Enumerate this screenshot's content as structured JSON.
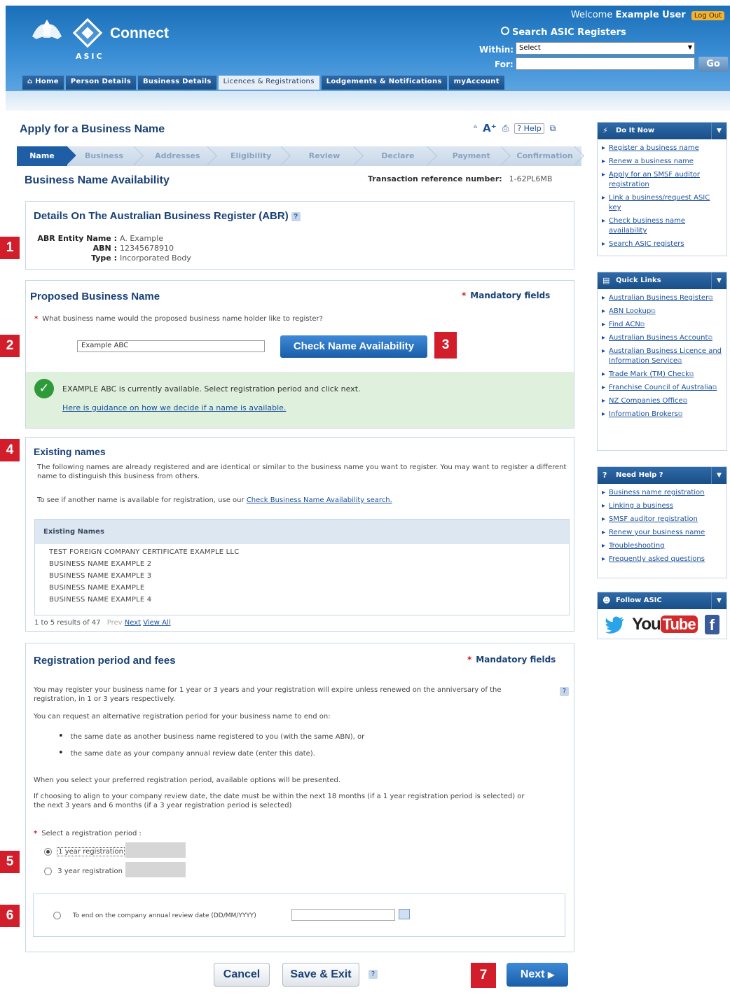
{
  "header": {
    "brand": "Connect",
    "brand_sub": "ASIC",
    "welcome_prefix": "Welcome",
    "user_name": "Example User",
    "logout_label": "Log Out",
    "search_title": "Search ASIC Registers",
    "within_label": "Within:",
    "within_value": "Select",
    "for_label": "For:",
    "go_label": "Go",
    "tabs": [
      "Home",
      "Person Details",
      "Business Details",
      "Licences & Registrations",
      "Lodgements & Notifications",
      "myAccount"
    ]
  },
  "page": {
    "title": "Apply for a Business Name",
    "help_label": "Help",
    "steps": [
      "Name",
      "Business",
      "Addresses",
      "Eligibility",
      "Review",
      "Declare",
      "Payment",
      "Confirmation"
    ],
    "section_title": "Business Name Availability",
    "txn_label": "Transaction reference number:",
    "txn_value": "1-62PL6MB"
  },
  "abr": {
    "title": "Details On The Australian Business Register (ABR)",
    "entity_label": "ABR Entity Name :",
    "entity_value": "A. Example",
    "abn_label": "ABN :",
    "abn_value": "12345678910",
    "type_label": "Type :",
    "type_value": "Incorporated Body"
  },
  "proposed": {
    "title": "Proposed Business Name",
    "mandatory": "Mandatory fields",
    "question": "What business name would the proposed business name holder like to register?",
    "input_value": "Example ABC",
    "check_button": "Check Name Availability",
    "available_msg": "EXAMPLE ABC is currently available. Select registration period and click next.",
    "guidance_link": "Here is guidance on how we decide if a name is available."
  },
  "existing": {
    "title": "Existing names",
    "intro": "The following names are already registered and are identical or similar to the business name you want to register. You may want to register a different name to distinguish this business from others.",
    "see_prefix": "To see if another name is available for registration, use our",
    "see_link": "Check Business Name Availability search.",
    "table_header": "Existing Names",
    "names": [
      "TEST FOREIGN COMPANY CERTIFICATE EXAMPLE LLC",
      "BUSINESS NAME EXAMPLE 2",
      "BUSINESS NAME EXAMPLE 3",
      "BUSINESS NAME EXAMPLE",
      "BUSINESS NAME EXAMPLE 4"
    ],
    "pager_text": "1 to 5 results of 47",
    "prev": "Prev",
    "next": "Next",
    "view_all": "View All"
  },
  "registration": {
    "title": "Registration period and fees",
    "mandatory": "Mandatory fields",
    "p1": "You may register your business name for 1 year or 3 years and your registration will expire unless renewed on the anniversary of the registration, in 1 or 3 years respectively.",
    "p2": "You can request an alternative registration period for your business name to end on:",
    "b1": "the same date as another business name registered to you (with the same ABN), or",
    "b2": "the same date as your company annual review date (enter this date).",
    "p3": "When you select your preferred registration period, available options will be presented.",
    "p4": "If choosing to align to your company review date, the date must be within the next 18 months (if a 1 year registration period is selected) or the next 3 years and 6 months (if a 3 year registration period is selected)",
    "select_label": "Select a registration period :",
    "opt1": "1 year registration",
    "opt2": "3 year registration",
    "opt3": "To end on the company annual review date (DD/MM/YYYY)"
  },
  "actions": {
    "cancel": "Cancel",
    "save_exit": "Save & Exit",
    "next": "Next"
  },
  "markers": [
    "1",
    "2",
    "3",
    "4",
    "5",
    "6",
    "7"
  ],
  "sidebar": {
    "do_it_now": {
      "title": "Do It Now",
      "items": [
        "Register a business name",
        "Renew a business name",
        "Apply for an SMSF auditor registration",
        "Link a business/request ASIC key",
        "Check business name availability",
        "Search ASIC registers"
      ]
    },
    "quick_links": {
      "title": "Quick Links",
      "items": [
        "Australian Business Register",
        "ABN Lookup",
        "Find ACN",
        "Australian Business Account",
        "Australian Business Licence and Information Service",
        "Trade Mark (TM) Check",
        "Franchise Council of Australia",
        "NZ Companies Office",
        "Information Brokers"
      ]
    },
    "need_help": {
      "title": "Need Help ?",
      "items": [
        "Business name registration",
        "Linking a business",
        "SMSF auditor registration",
        "Renew your business name",
        "Troubleshooting",
        "Frequently asked questions"
      ]
    },
    "follow": {
      "title": "Follow ASIC",
      "yt_you": "You",
      "yt_tube": "Tube",
      "fb": "f"
    }
  },
  "colors": {
    "brand_blue": "#1a5ea8",
    "marker_red": "#d21e2b",
    "success_green": "#2e9a3a",
    "success_bg": "#dff0dd"
  }
}
